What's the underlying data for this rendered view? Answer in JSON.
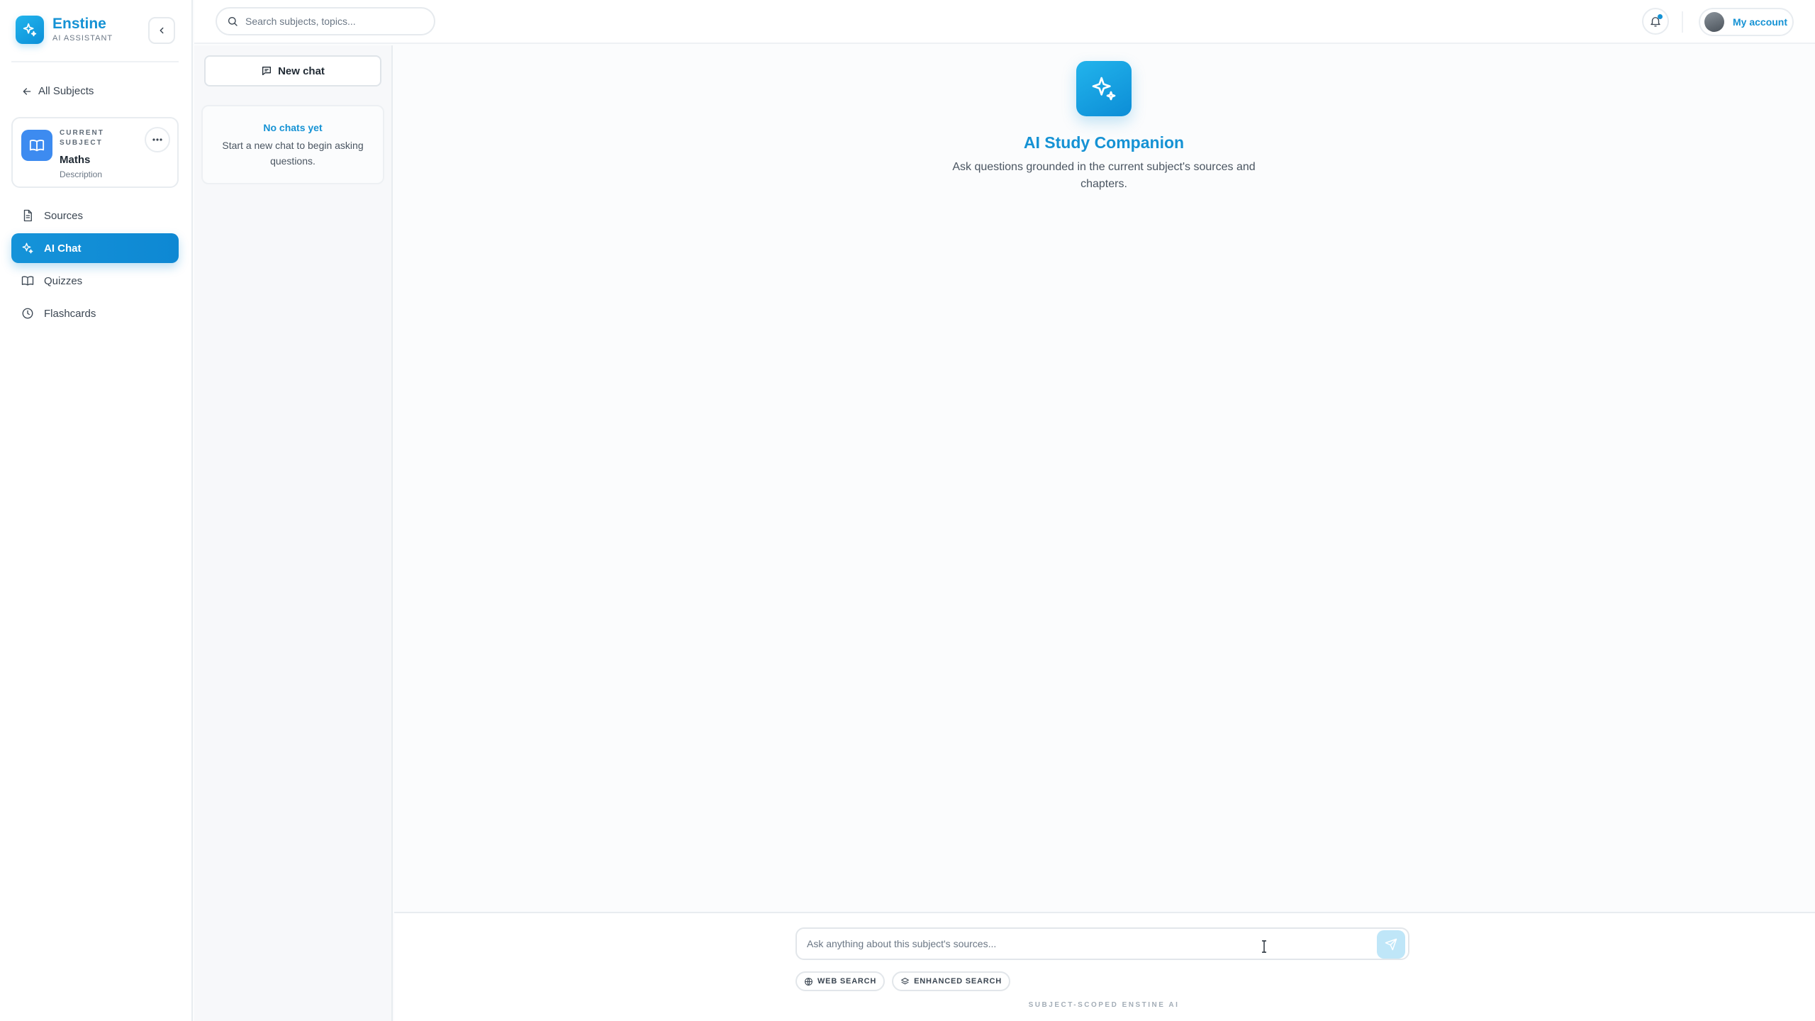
{
  "brand": {
    "name": "Enstine",
    "subtitle": "AI ASSISTANT",
    "logo_icon": "sparkles-icon"
  },
  "sidebar": {
    "collapse_icon": "chevron-left-icon",
    "back_label": "All Subjects",
    "subject": {
      "kicker": "CURRENT SUBJECT",
      "name": "Maths",
      "description": "Description",
      "icon": "book-open-icon"
    },
    "items": [
      {
        "label": "Sources",
        "icon": "file-text-icon",
        "active": false
      },
      {
        "label": "AI Chat",
        "icon": "sparkles-icon",
        "active": true
      },
      {
        "label": "Quizzes",
        "icon": "book-open-icon",
        "active": false
      },
      {
        "label": "Flashcards",
        "icon": "clock-icon",
        "active": false
      }
    ]
  },
  "topbar": {
    "search_placeholder": "Search subjects, topics...",
    "account_label": "My account",
    "notification_icon": "bell-icon"
  },
  "chatlist": {
    "new_chat_label": "New chat",
    "empty_title": "No chats yet",
    "empty_text": "Start a new chat to begin asking questions."
  },
  "main": {
    "hero_title": "AI Study Companion",
    "hero_subtitle": "Ask questions grounded in the current subject's sources and chapters.",
    "input_placeholder": "Ask anything about this subject's sources...",
    "chips": [
      "WEB SEARCH",
      "ENHANCED SEARCH"
    ],
    "footnote": "SUBJECT-SCOPED ENSTINE AI"
  },
  "colors": {
    "accent": "#1592d4",
    "accent_light": "#bfe6f8",
    "border": "#e8ecf0",
    "subject_icon_bg": "#3d8bf0"
  }
}
